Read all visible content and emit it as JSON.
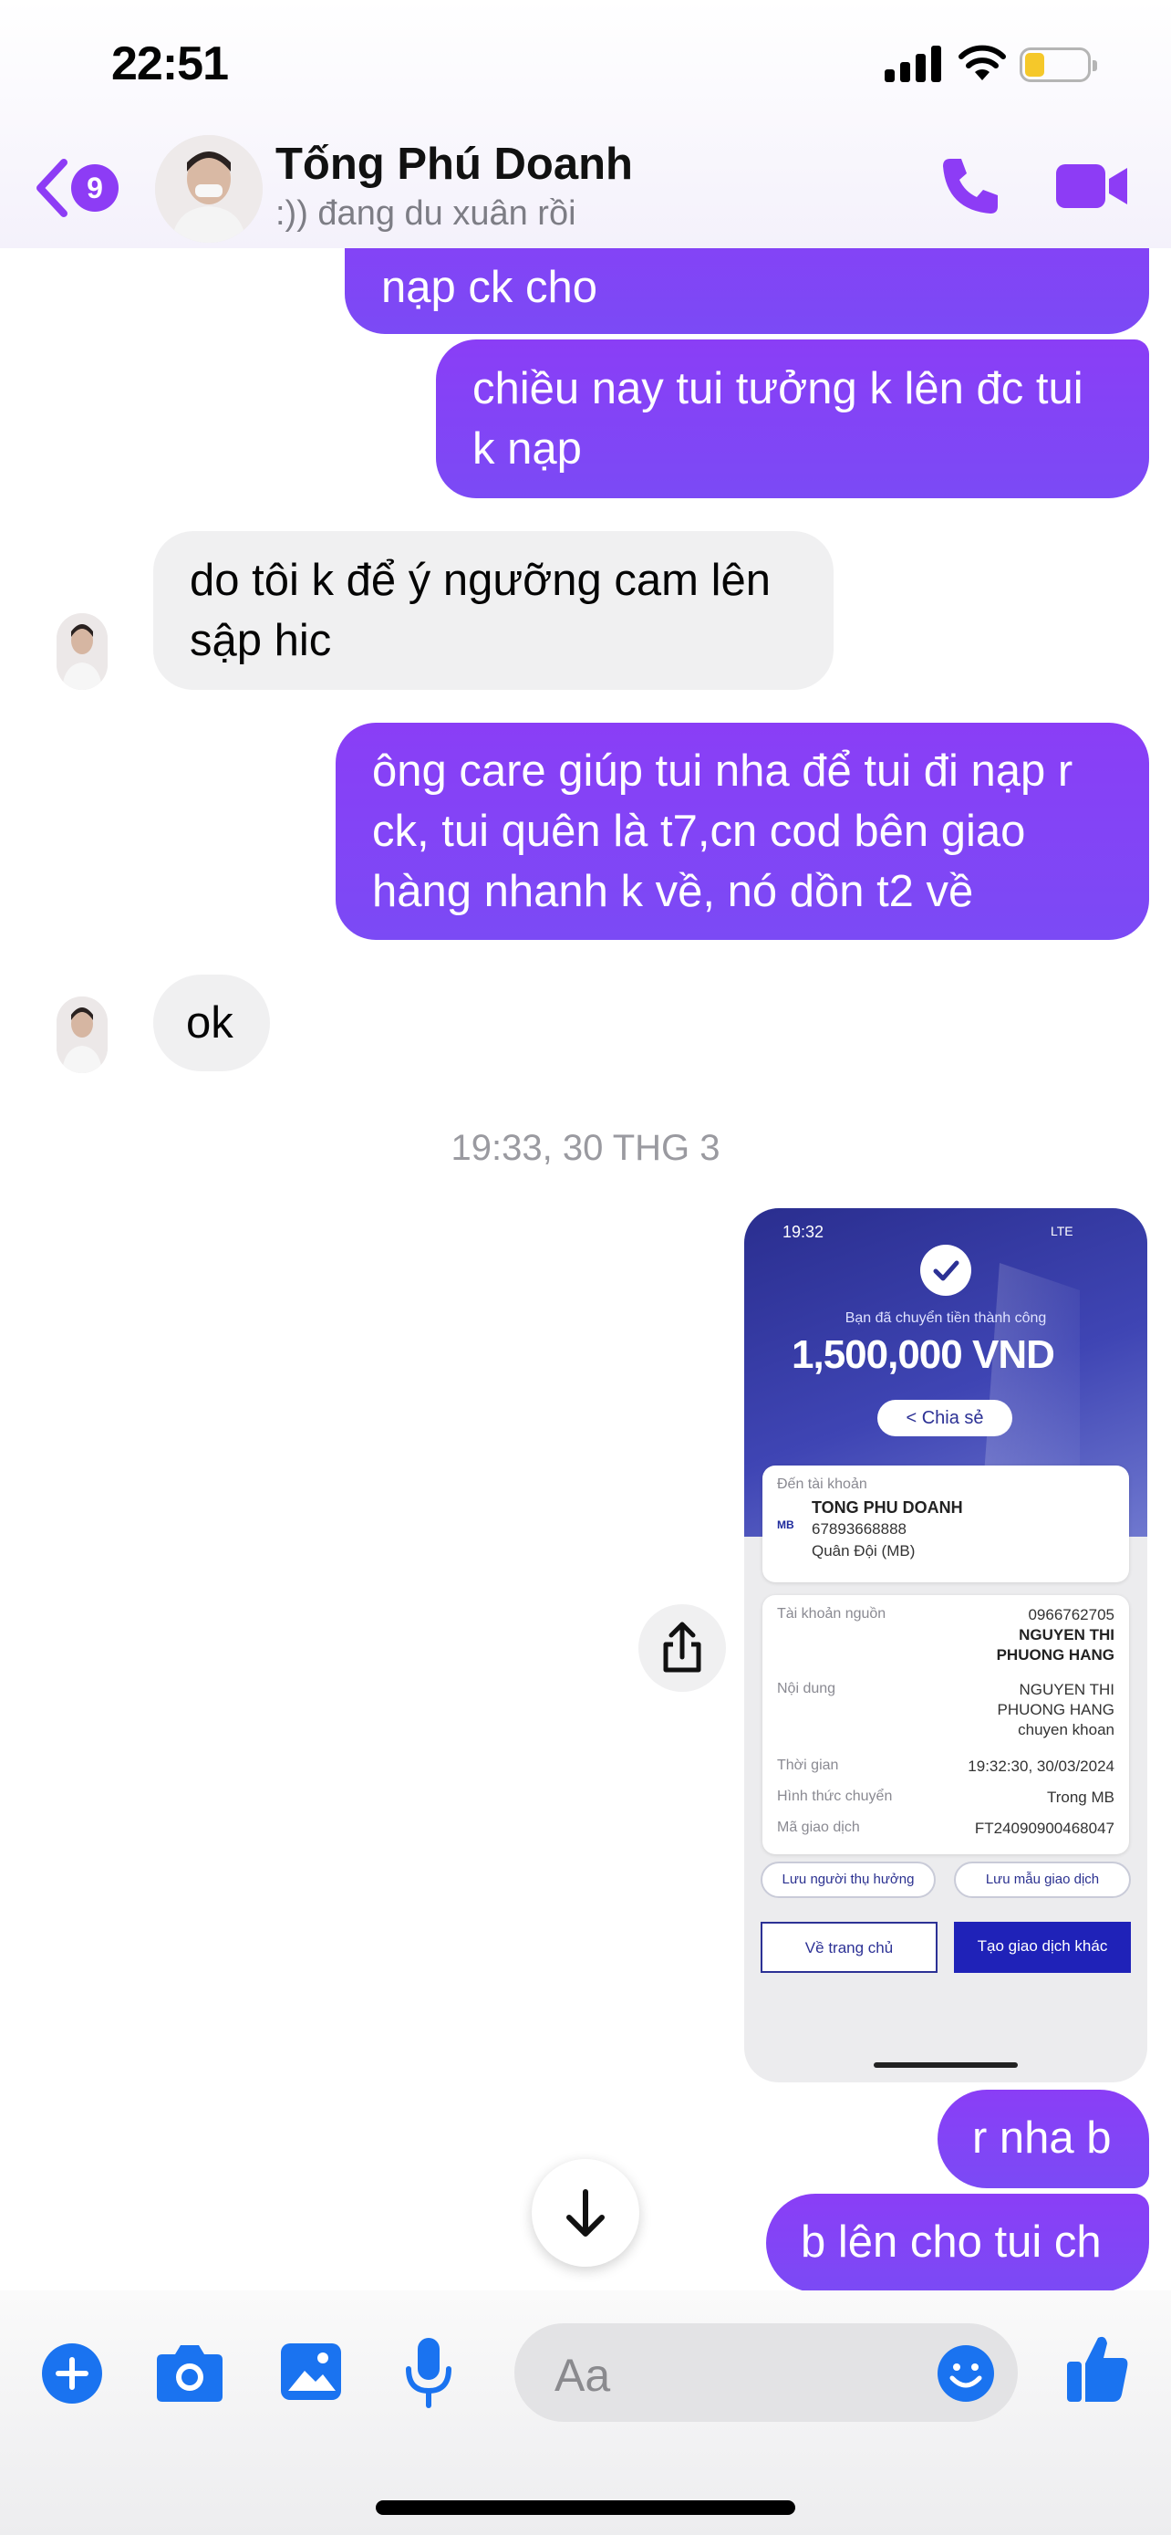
{
  "status_bar": {
    "time": "22:51"
  },
  "header": {
    "unread_count": "9",
    "contact_name": "Tống Phú Doanh",
    "contact_status": ":)) đang du xuân rồi"
  },
  "messages": [
    {
      "from": "me",
      "text": "nạp ck cho"
    },
    {
      "from": "me",
      "lines": [
        "chiều nay tui tưởng k lên đc tui",
        "k nạp"
      ]
    },
    {
      "from": "them",
      "lines": [
        "do tôi k để ý ngưỡng cam lên",
        "sập hic"
      ]
    },
    {
      "from": "me",
      "lines": [
        "ông care giúp tui nha để tui đi nạp r",
        "ck, tui quên là t7,cn cod bên giao",
        "hàng nhanh k về, nó dồn t2 về"
      ]
    },
    {
      "from": "them",
      "text": "ok"
    },
    {
      "from": "me",
      "text": "r nha b"
    },
    {
      "from": "me",
      "text": "b lên cho tui ch"
    }
  ],
  "timestamp": "19:33, 30 THG 3",
  "receipt": {
    "time": "19:32",
    "network": "LTE",
    "subtitle": "Bạn đã chuyển tiền thành công",
    "amount": "1,500,000 VND",
    "share_label": "Chia sẻ",
    "to_account_label": "Đến tài khoản",
    "bank_logo": "MB",
    "recipient_name": "TONG PHU DOANH",
    "recipient_account": "67893668888",
    "recipient_bank": "Quân Đội (MB)",
    "source_account_label": "Tài khoản nguồn",
    "source_account": "0966762705",
    "source_name_1": "NGUYEN THI",
    "source_name_2": "PHUONG HANG",
    "content_label": "Nội dung",
    "content_1": "NGUYEN THI",
    "content_2": "PHUONG HANG",
    "content_3": "chuyen khoan",
    "time_label": "Thời gian",
    "time_value": "19:32:30, 30/03/2024",
    "method_label": "Hình thức chuyển",
    "method_value": "Trong MB",
    "txn_label": "Mã giao dịch",
    "txn_value": "FT24090900468047",
    "save_recipient": "Lưu người thụ hưởng",
    "save_template": "Lưu mẫu giao dịch",
    "home_button": "Về trang chủ",
    "new_txn_button": "Tạo giao dịch khác"
  },
  "composer": {
    "placeholder": "Aa"
  },
  "colors": {
    "accent": "#8a3ef6",
    "outgoing": "#7b4af5",
    "incoming": "#f0f0f1",
    "icon_blue": "#1a73f0"
  }
}
